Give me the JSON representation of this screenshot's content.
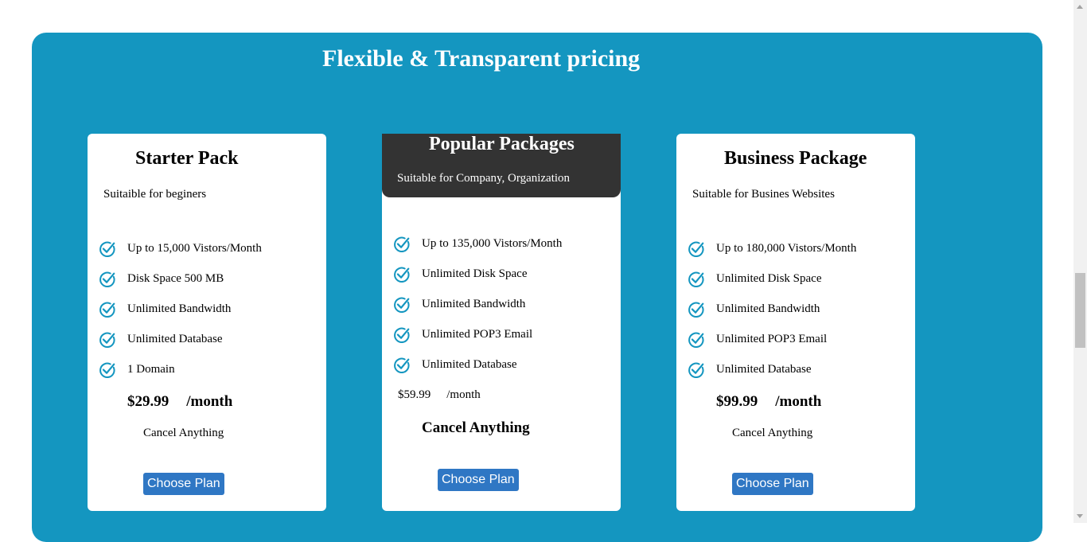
{
  "section": {
    "title": "Flexible & Transparent pricing"
  },
  "plans": [
    {
      "name": "Starter Pack",
      "subtitle": "Suitaible for beginers",
      "features": [
        "Up to 15,000 Vistors/Month",
        "Disk Space 500 MB",
        "Unlimited Bandwidth",
        "Unlimited Database",
        "1 Domain"
      ],
      "price": "$29.99",
      "period": "/month",
      "note": "Cancel Anything",
      "button": "Choose Plan"
    },
    {
      "name": "Popular Packages",
      "subtitle": "Suitable for Company, Organization",
      "features": [
        "Up to 135,000 Vistors/Month",
        "Unlimited Disk Space",
        "Unlimited Bandwidth",
        "Unlimited POP3 Email",
        "Unlimited Database"
      ],
      "price": "$59.99",
      "period": "/month",
      "note": "Cancel Anything",
      "button": "Choose Plan"
    },
    {
      "name": "Business Package",
      "subtitle": "Suitable for Busines Websites",
      "features": [
        "Up to 180,000 Vistors/Month",
        "Unlimited Disk Space",
        "Unlimited Bandwidth",
        "Unlimited POP3 Email",
        "Unlimited Database"
      ],
      "price": "$99.99",
      "period": "/month",
      "note": "Cancel Anything",
      "button": "Choose Plan"
    }
  ],
  "icons": {
    "feature": "check-circle-icon"
  },
  "colors": {
    "section_bg": "#1496c0",
    "popular_header": "#333333",
    "button": "#2f77c4",
    "check": "#1496c0"
  }
}
